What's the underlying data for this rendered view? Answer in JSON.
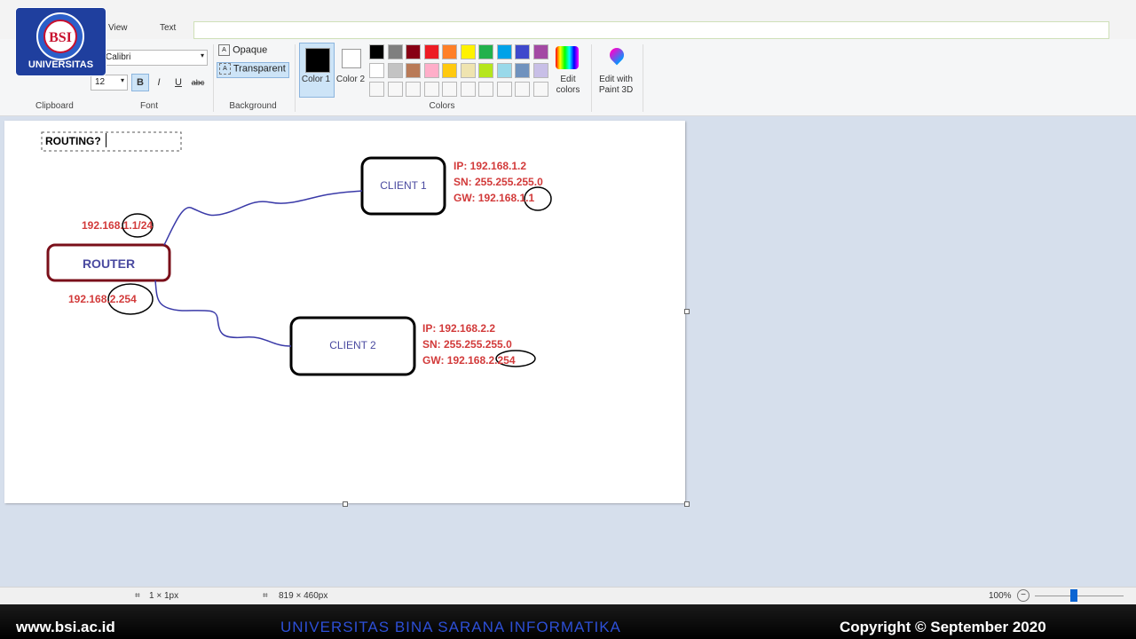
{
  "tabs": {
    "view": "View",
    "text": "Text"
  },
  "font": {
    "name": "Calibri",
    "size": "12",
    "group_label": "Font",
    "bold": "B",
    "italic": "I",
    "underline": "U",
    "strike": "abc"
  },
  "clipboard": {
    "group_label": "Clipboard"
  },
  "background": {
    "opaque": "Opaque",
    "transparent": "Transparent",
    "group_label": "Background"
  },
  "colors": {
    "color1": "Color 1",
    "color2": "Color 2",
    "group_label": "Colors",
    "edit_colors": "Edit colors",
    "paint3d": "Edit with Paint 3D",
    "row1": [
      "#000000",
      "#7f7f7f",
      "#880015",
      "#ed1c24",
      "#ff7f27",
      "#fff200",
      "#22b14c",
      "#00a2e8",
      "#3f48cc",
      "#a349a4"
    ],
    "row2": [
      "#ffffff",
      "#c3c3c3",
      "#b97a57",
      "#ffaec9",
      "#ffc90e",
      "#efe4b0",
      "#b5e61d",
      "#99d9ea",
      "#7092be",
      "#c8bfe7"
    ]
  },
  "drawing": {
    "title_text": "ROUTING?",
    "router": "ROUTER",
    "client1": "CLIENT 1",
    "client2": "CLIENT 2",
    "router_ip1": "192.168.1.1/24",
    "router_ip2": "192.168.2.254",
    "c1_ip": "IP: 192.168.1.2",
    "c1_sn": "SN: 255.255.255.0",
    "c1_gw": "GW: 192.168.1.1",
    "c2_ip": "IP: 192.168.2.2",
    "c2_sn": "SN: 255.255.255.0",
    "c2_gw": "GW: 192.168.2.254"
  },
  "status": {
    "pixel": "1 × 1px",
    "canvas_size": "819 × 460px",
    "zoom": "100%"
  },
  "logo": {
    "text": "UNIVERSITAS",
    "badge": "BSI"
  },
  "footer": {
    "left": "www.bsi.ac.id",
    "center": "UNIVERSITAS BINA SARANA INFORMATIKA",
    "right": "Copyright © September 2020"
  }
}
